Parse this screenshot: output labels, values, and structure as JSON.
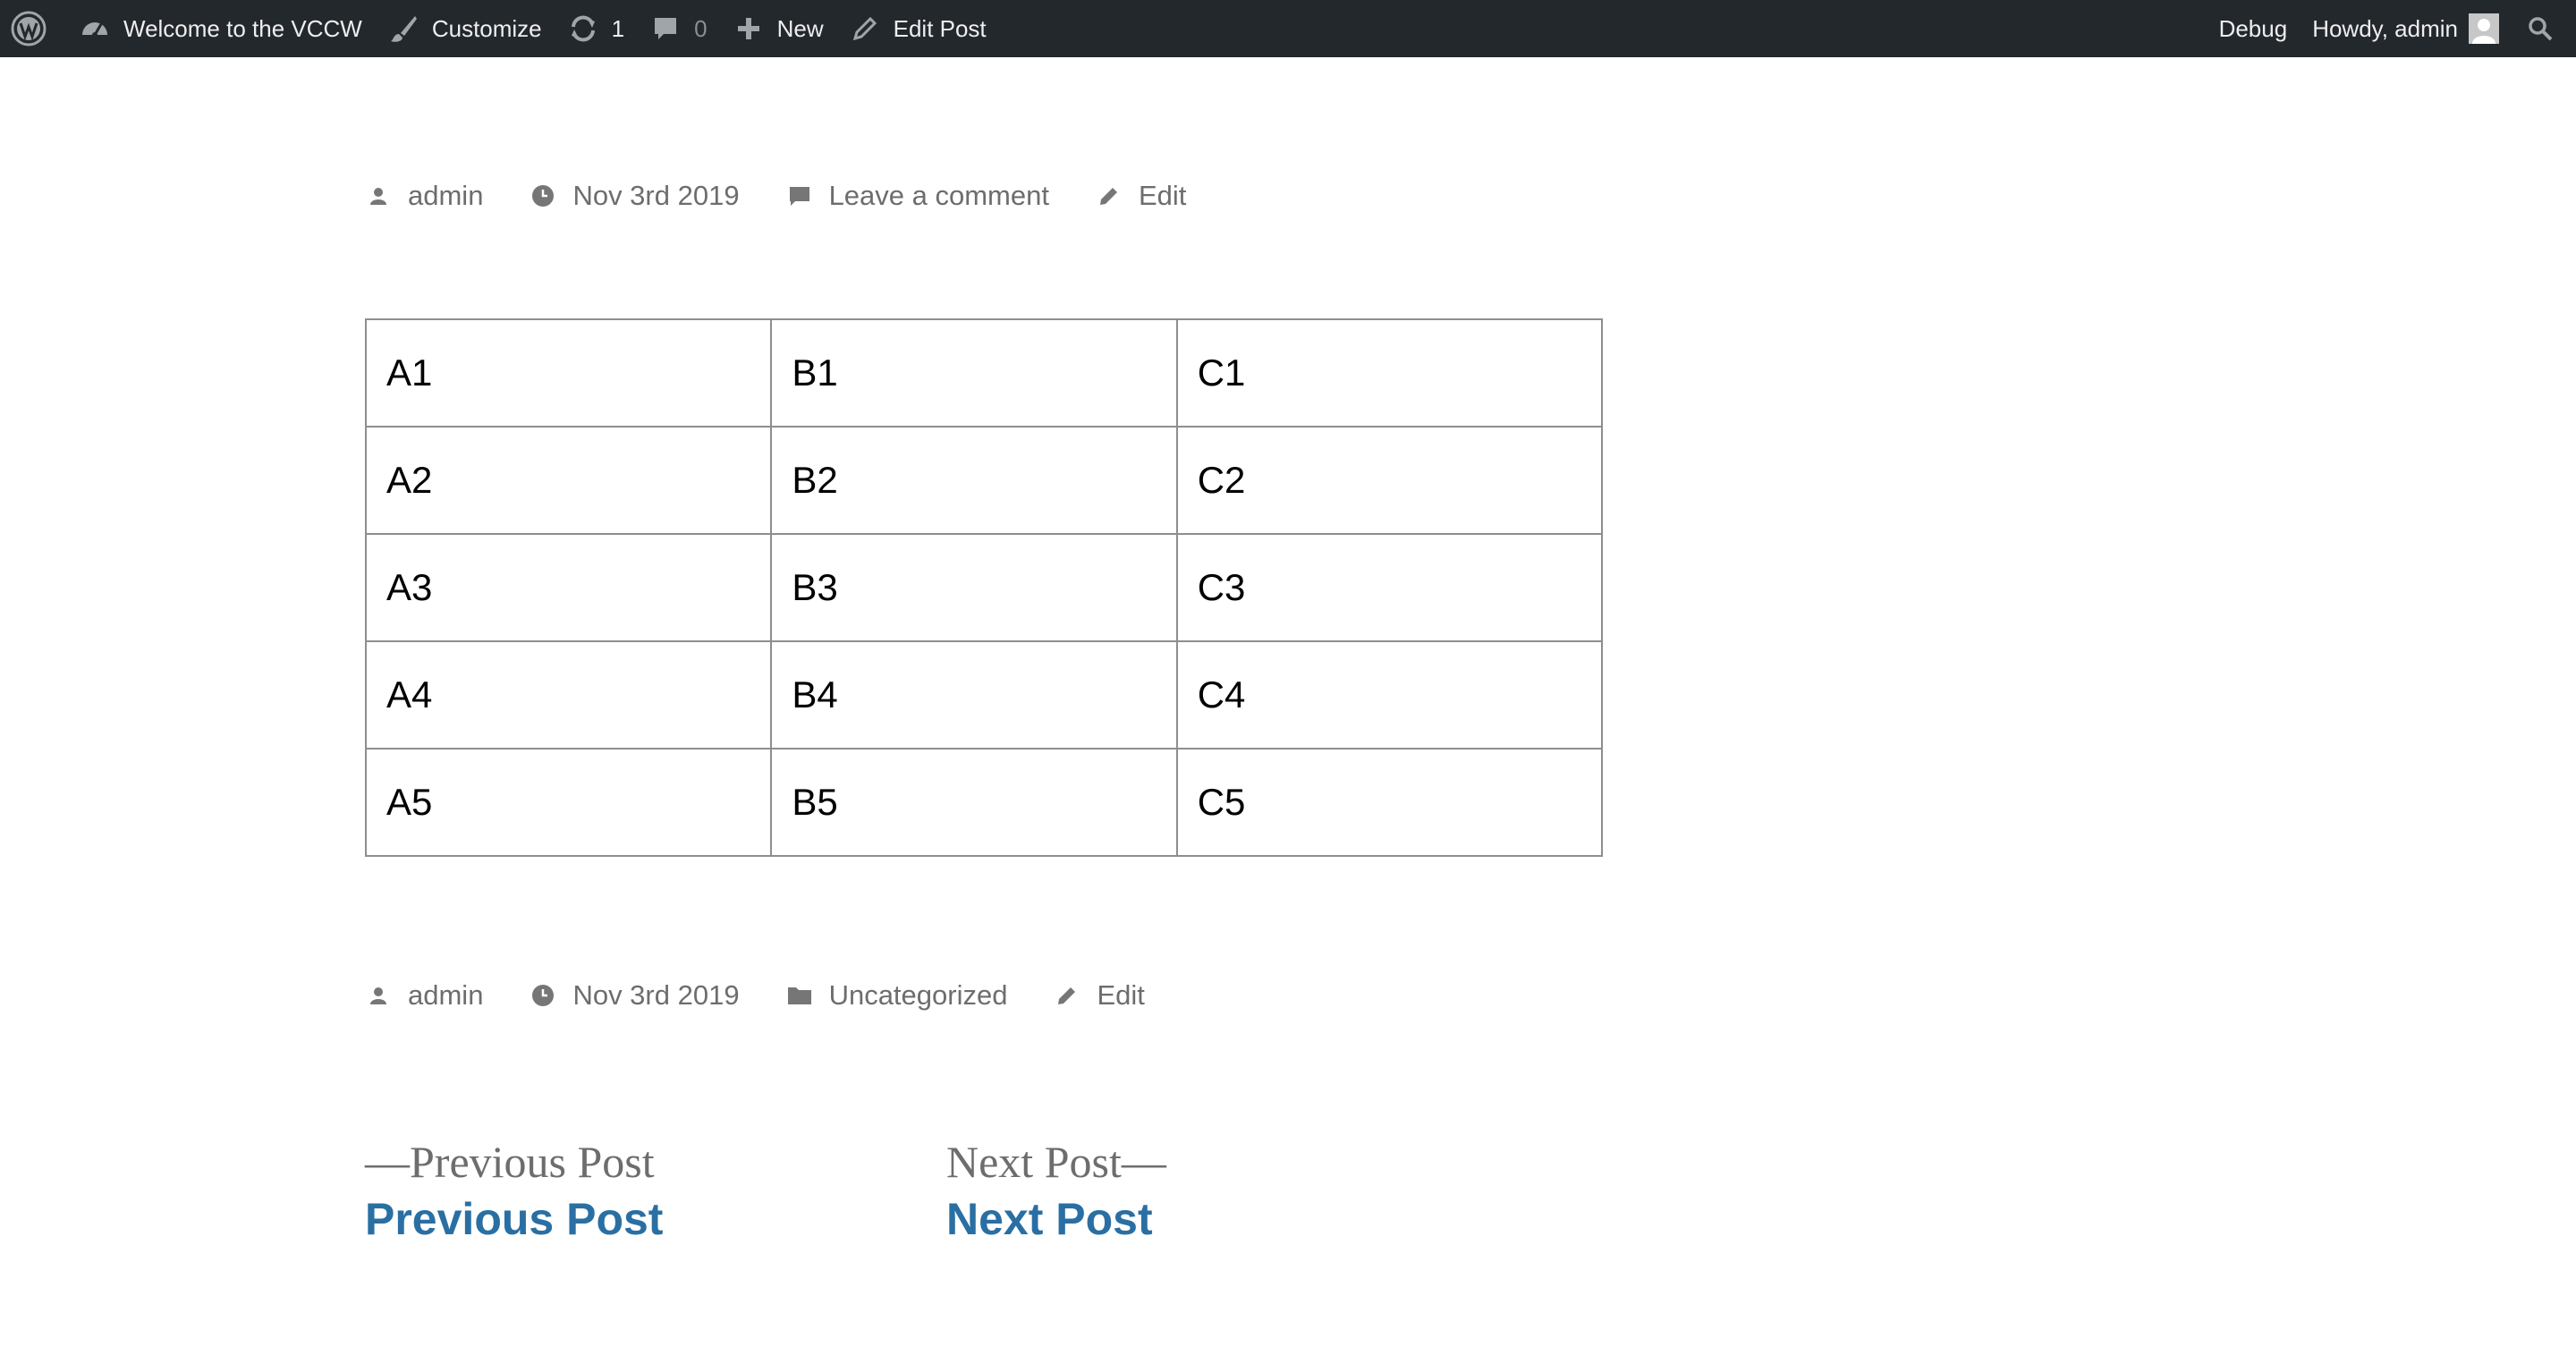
{
  "adminbar": {
    "logo_icon": "wordpress-icon",
    "site_name": "Welcome to the VCCW",
    "customize": "Customize",
    "updates_count": "1",
    "comments_count": "0",
    "new_label": "New",
    "edit_post": "Edit Post",
    "debug": "Debug",
    "howdy": "Howdy, admin",
    "background_color": "#23282d"
  },
  "post_meta_top": {
    "author": "admin",
    "date": "Nov 3rd 2019",
    "comment_link": "Leave a comment",
    "edit": "Edit"
  },
  "table": {
    "rows": [
      [
        "A1",
        "B1",
        "C1"
      ],
      [
        "A2",
        "B2",
        "C2"
      ],
      [
        "A3",
        "B3",
        "C3"
      ],
      [
        "A4",
        "B4",
        "C4"
      ],
      [
        "A5",
        "B5",
        "C5"
      ]
    ]
  },
  "post_meta_bottom": {
    "author": "admin",
    "date": "Nov 3rd 2019",
    "category": "Uncategorized",
    "edit": "Edit"
  },
  "post_nav": {
    "prev_meta": "—Previous Post",
    "prev_title": "Previous Post",
    "next_meta": "Next Post—",
    "next_title": "Next Post",
    "link_color": "#2a6fa3"
  }
}
